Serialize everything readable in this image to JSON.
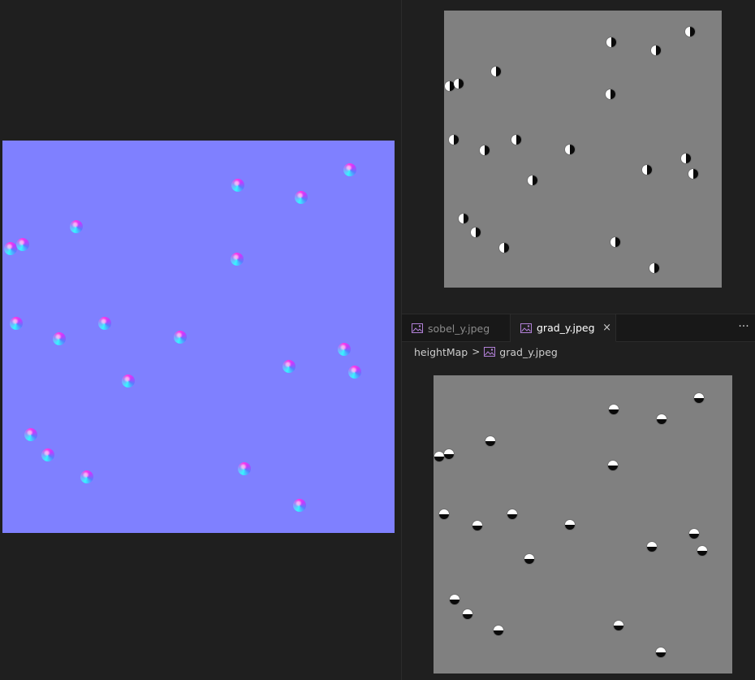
{
  "tabs": [
    {
      "label": "sobel_y.jpeg",
      "icon": "image-file-icon",
      "active": false
    },
    {
      "label": "grad_y.jpeg",
      "icon": "image-file-icon",
      "active": true,
      "close": "×"
    }
  ],
  "more_actions": "···",
  "breadcrumb": {
    "folder": "heightMap",
    "separator": ">",
    "file": "grad_y.jpeg"
  },
  "colors": {
    "background": "#1f1f1f",
    "tabbar": "#181818",
    "normal_map": "#7f80ff",
    "gray_image": "#808080",
    "icon_accent": "#b180d7"
  }
}
